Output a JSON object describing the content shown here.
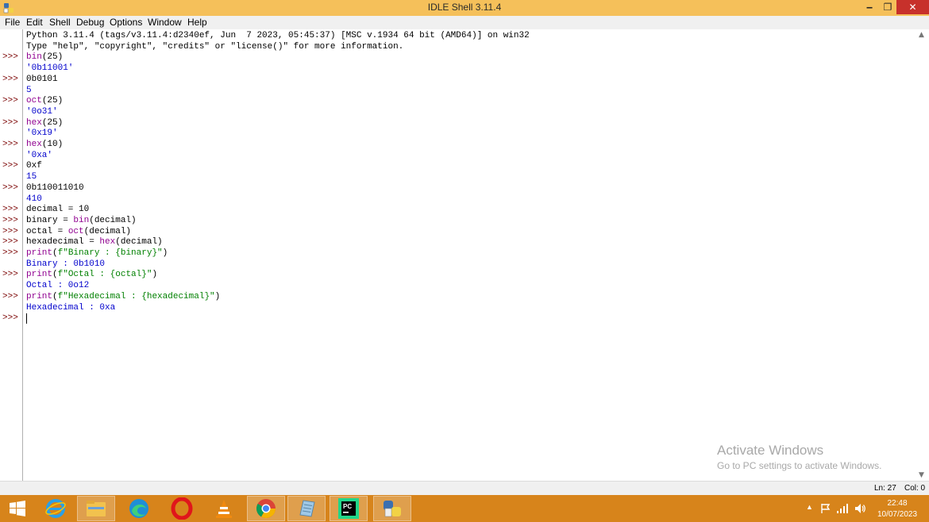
{
  "window": {
    "title": "IDLE Shell 3.11.4",
    "min": "‒",
    "max": "❐",
    "close": "✕"
  },
  "menu": [
    "File",
    "Edit",
    "Shell",
    "Debug",
    "Options",
    "Window",
    "Help"
  ],
  "banner": [
    "Python 3.11.4 (tags/v3.11.4:d2340ef, Jun  7 2023, 05:45:37) [MSC v.1934 64 bit (AMD64)] on win32",
    "Type \"help\", \"copyright\", \"credits\" or \"license()\" for more information."
  ],
  "prompt": ">>>",
  "lines": [
    {
      "row": 2,
      "kind": "in",
      "parts": [
        {
          "t": "bin",
          "c": "builtin"
        },
        {
          "t": "(25)",
          "c": "in"
        }
      ]
    },
    {
      "row": 3,
      "kind": "out",
      "parts": [
        {
          "t": "'0b11001'",
          "c": "out"
        }
      ]
    },
    {
      "row": 4,
      "kind": "in",
      "parts": [
        {
          "t": "0b0101",
          "c": "in"
        }
      ]
    },
    {
      "row": 5,
      "kind": "out",
      "parts": [
        {
          "t": "5",
          "c": "out"
        }
      ]
    },
    {
      "row": 6,
      "kind": "in",
      "parts": [
        {
          "t": "oct",
          "c": "builtin"
        },
        {
          "t": "(25)",
          "c": "in"
        }
      ]
    },
    {
      "row": 7,
      "kind": "out",
      "parts": [
        {
          "t": "'0o31'",
          "c": "out"
        }
      ]
    },
    {
      "row": 8,
      "kind": "in",
      "parts": [
        {
          "t": "hex",
          "c": "builtin"
        },
        {
          "t": "(25)",
          "c": "in"
        }
      ]
    },
    {
      "row": 9,
      "kind": "out",
      "parts": [
        {
          "t": "'0x19'",
          "c": "out"
        }
      ]
    },
    {
      "row": 10,
      "kind": "in",
      "parts": [
        {
          "t": "hex",
          "c": "builtin"
        },
        {
          "t": "(10)",
          "c": "in"
        }
      ]
    },
    {
      "row": 11,
      "kind": "out",
      "parts": [
        {
          "t": "'0xa'",
          "c": "out"
        }
      ]
    },
    {
      "row": 12,
      "kind": "in",
      "parts": [
        {
          "t": "0xf",
          "c": "in"
        }
      ]
    },
    {
      "row": 13,
      "kind": "out",
      "parts": [
        {
          "t": "15",
          "c": "out"
        }
      ]
    },
    {
      "row": 14,
      "kind": "in",
      "parts": [
        {
          "t": "0b110011010",
          "c": "in"
        }
      ]
    },
    {
      "row": 15,
      "kind": "out",
      "parts": [
        {
          "t": "410",
          "c": "out"
        }
      ]
    },
    {
      "row": 16,
      "kind": "in",
      "parts": [
        {
          "t": "decimal = 10",
          "c": "in"
        }
      ]
    },
    {
      "row": 17,
      "kind": "in",
      "parts": [
        {
          "t": "binary = ",
          "c": "in"
        },
        {
          "t": "bin",
          "c": "builtin"
        },
        {
          "t": "(decimal)",
          "c": "in"
        }
      ]
    },
    {
      "row": 18,
      "kind": "in",
      "parts": [
        {
          "t": "octal = ",
          "c": "in"
        },
        {
          "t": "oct",
          "c": "builtin"
        },
        {
          "t": "(decimal)",
          "c": "in"
        }
      ]
    },
    {
      "row": 19,
      "kind": "in",
      "parts": [
        {
          "t": "hexadecimal = ",
          "c": "in"
        },
        {
          "t": "hex",
          "c": "builtin"
        },
        {
          "t": "(decimal)",
          "c": "in"
        }
      ]
    },
    {
      "row": 20,
      "kind": "in",
      "parts": [
        {
          "t": "print",
          "c": "builtin"
        },
        {
          "t": "(",
          "c": "in"
        },
        {
          "t": "f\"Binary : {binary}\"",
          "c": "str"
        },
        {
          "t": ")",
          "c": "in"
        }
      ]
    },
    {
      "row": 21,
      "kind": "out",
      "parts": [
        {
          "t": "Binary : 0b1010",
          "c": "out"
        }
      ]
    },
    {
      "row": 22,
      "kind": "in",
      "parts": [
        {
          "t": "print",
          "c": "builtin"
        },
        {
          "t": "(",
          "c": "in"
        },
        {
          "t": "f\"Octal : {octal}\"",
          "c": "str"
        },
        {
          "t": ")",
          "c": "in"
        }
      ]
    },
    {
      "row": 23,
      "kind": "out",
      "parts": [
        {
          "t": "Octal : 0o12",
          "c": "out"
        }
      ]
    },
    {
      "row": 24,
      "kind": "in",
      "parts": [
        {
          "t": "print",
          "c": "builtin"
        },
        {
          "t": "(",
          "c": "in"
        },
        {
          "t": "f\"Hexadecimal : {hexadecimal}\"",
          "c": "str"
        },
        {
          "t": ")",
          "c": "in"
        }
      ]
    },
    {
      "row": 25,
      "kind": "out",
      "parts": [
        {
          "t": "Hexadecimal : 0xa",
          "c": "out"
        }
      ]
    },
    {
      "row": 26,
      "kind": "in",
      "parts": []
    }
  ],
  "status": {
    "ln": "Ln: 27",
    "col": "Col: 0"
  },
  "watermark": {
    "line1": "Activate Windows",
    "line2": "Go to PC settings to activate Windows."
  },
  "taskbar": {
    "apps": [
      {
        "name": "start-button",
        "icon": "windows-logo-icon",
        "active": false
      },
      {
        "name": "taskbar-ie",
        "icon": "internet-explorer-icon",
        "active": false
      },
      {
        "name": "taskbar-file-explorer",
        "icon": "folder-icon",
        "active": false
      },
      {
        "name": "taskbar-edge",
        "icon": "edge-icon",
        "active": false
      },
      {
        "name": "taskbar-opera",
        "icon": "opera-icon",
        "active": false
      },
      {
        "name": "taskbar-vlc",
        "icon": "vlc-cone-icon",
        "active": false
      },
      {
        "name": "taskbar-chrome",
        "icon": "chrome-icon",
        "active": true
      },
      {
        "name": "taskbar-notepad",
        "icon": "notepad-icon",
        "active": false
      },
      {
        "name": "taskbar-pycharm",
        "icon": "pycharm-icon",
        "active": true
      },
      {
        "name": "taskbar-python",
        "icon": "python-icon",
        "active": true
      }
    ],
    "time": "22:48",
    "date": "10/07/2023"
  }
}
